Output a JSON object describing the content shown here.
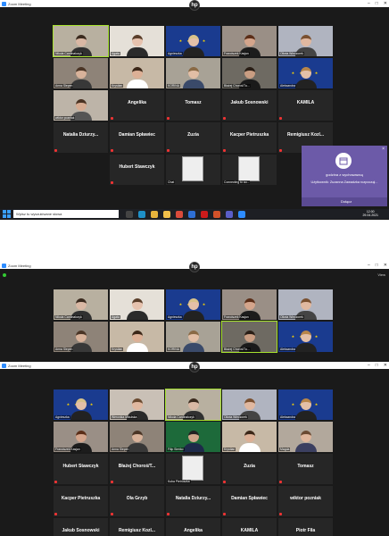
{
  "window": {
    "title": "Zoom Meeting",
    "logo_text": "hp",
    "controls": [
      "–",
      "□",
      "✕"
    ]
  },
  "screenshot1": {
    "rows": [
      [
        {
          "name": "Nikola Cardinalczyk",
          "style": "video",
          "skin": "#d9b8a4",
          "hair": "#3a2a1e",
          "shirt": "#303030",
          "bg": "#b8b0a0",
          "active": true
        },
        {
          "name": "Agata",
          "style": "video",
          "skin": "#e6c2ae",
          "hair": "#5a3e2a",
          "shirt": "#2b2b2b",
          "bg": "#e5e0d8"
        },
        {
          "name": "Agnieszka",
          "style": "flag",
          "skin": "#e3c0a8",
          "hair": "#d8c28a",
          "shirt": "#222"
        },
        {
          "name": "Franciszek Kasjan",
          "style": "video",
          "skin": "#d4a58c",
          "hair": "#5b2e18",
          "shirt": "#1c1c1c",
          "bg": "#9a8f86"
        },
        {
          "name": "Oliwia Wieczorek",
          "style": "video",
          "skin": "#e0b8a0",
          "hair": "#7a5030",
          "shirt": "#444",
          "bg": "#b0b4c0"
        }
      ],
      [
        {
          "name": "Anna Slepen",
          "style": "video",
          "skin": "#d8b29a",
          "hair": "#4b3526",
          "shirt": "#383838",
          "bg": "#8e8378"
        },
        {
          "name": "Krystian",
          "style": "video",
          "skin": "#dcb096",
          "hair": "#3c2718",
          "shirt": "#ffffff",
          "bg": "#c7b9a6"
        },
        {
          "name": "KORINA",
          "style": "video",
          "skin": "#e2bea5",
          "hair": "#8a6a45",
          "shirt": "#3a4a6a",
          "bg": "#a8a296"
        },
        {
          "name": "Błażej Choroś/Tu...",
          "style": "video",
          "skin": "#c99d82",
          "hair": "#2a1e16",
          "shirt": "#1a1a1a",
          "bg": "#6e6a62"
        },
        {
          "name": "Aleksandra",
          "style": "flag",
          "skin": "#e3c0a8",
          "hair": "#b8864a",
          "shirt": "#222"
        }
      ],
      [
        {
          "name": "wiktor pozniak",
          "style": "video",
          "skin": "#d7ac92",
          "hair": "#4a3222",
          "shirt": "#555",
          "bg": "#bdb4a8"
        },
        {
          "name": "Angelika",
          "style": "text"
        },
        {
          "name": "Tomasz",
          "style": "text"
        },
        {
          "name": "Jakub Sosnowski",
          "style": "text"
        },
        {
          "name": "KAMILA",
          "style": "text"
        }
      ],
      [
        {
          "name": "Natalia Dziurzy...",
          "style": "text"
        },
        {
          "name": "Damian Spławiec",
          "style": "text"
        },
        {
          "name": "Zuzia",
          "style": "text"
        },
        {
          "name": "Kacper Pietruszka",
          "style": "text"
        },
        {
          "name": "Remigiusz Kozl...",
          "style": "text"
        }
      ],
      [
        {
          "name": "",
          "style": "empty"
        },
        {
          "name": "Hubert Stawczyk",
          "style": "text"
        },
        {
          "name": "Chat",
          "style": "anime"
        },
        {
          "name": "Connecting to au...",
          "style": "anime"
        },
        {
          "name": "",
          "style": "empty"
        }
      ]
    ],
    "taskbar": {
      "search_placeholder": "Wpisz tu wyszukiwane słowa",
      "time": "12:00",
      "date": "29.04.2021"
    },
    "notification": {
      "title": "godzina z wychowawcą",
      "message": "Użytkownik: Zuzanna Zawadzka rozpoczął...",
      "join_label": "Dołącz"
    }
  },
  "screenshot2": {
    "views_label": "View",
    "rows": [
      [
        {
          "name": "Nikola Cardinalczyk",
          "style": "video",
          "skin": "#d9b8a4",
          "hair": "#3a2a1e",
          "shirt": "#303030",
          "bg": "#b8b0a0"
        },
        {
          "name": "Agata",
          "style": "video",
          "skin": "#e6c2ae",
          "hair": "#5a3e2a",
          "shirt": "#2b2b2b",
          "bg": "#e5e0d8"
        },
        {
          "name": "Agnieszka",
          "style": "flag",
          "skin": "#e3c0a8",
          "hair": "#d8c28a",
          "shirt": "#222"
        },
        {
          "name": "Franciszek Kasjan",
          "style": "video",
          "skin": "#d4a58c",
          "hair": "#5b2e18",
          "shirt": "#1c1c1c",
          "bg": "#9a8f86"
        },
        {
          "name": "Oliwia Wieczorek",
          "style": "video",
          "skin": "#e0b8a0",
          "hair": "#7a5030",
          "shirt": "#444",
          "bg": "#b0b4c0"
        }
      ],
      [
        {
          "name": "Anna Slepen",
          "style": "video",
          "skin": "#d8b29a",
          "hair": "#4b3526",
          "shirt": "#383838",
          "bg": "#8e8378"
        },
        {
          "name": "Krystian",
          "style": "video",
          "skin": "#dcb096",
          "hair": "#3c2718",
          "shirt": "#ffffff",
          "bg": "#c7b9a6"
        },
        {
          "name": "KORINA",
          "style": "video",
          "skin": "#e2bea5",
          "hair": "#8a6a45",
          "shirt": "#3a4a6a",
          "bg": "#a8a296"
        },
        {
          "name": "Błażej Choroś/Tu...",
          "style": "video",
          "skin": "#c99d82",
          "hair": "#2a1e16",
          "shirt": "#1a1a1a",
          "bg": "#6e6a62",
          "active": true
        },
        {
          "name": "Aleksandra",
          "style": "flag",
          "skin": "#e3c0a8",
          "hair": "#b8864a",
          "shirt": "#222"
        }
      ]
    ]
  },
  "screenshot3": {
    "rows": [
      [
        {
          "name": "Agnieszka",
          "style": "flag",
          "skin": "#e3c0a8",
          "hair": "#d8c28a",
          "shirt": "#222"
        },
        {
          "name": "Weronika Mikulska",
          "style": "video",
          "skin": "#e0b8a0",
          "hair": "#6a4a30",
          "shirt": "#2a2a2a",
          "bg": "#c9c0b6"
        },
        {
          "name": "Nikola Cardinalczyk",
          "style": "video",
          "skin": "#d9b8a4",
          "hair": "#3a2a1e",
          "shirt": "#303030",
          "bg": "#b8b0a0",
          "active": true
        },
        {
          "name": "Oliwia Wieczorek",
          "style": "video",
          "skin": "#e0b8a0",
          "hair": "#7a5030",
          "shirt": "#444",
          "bg": "#b0b4c0"
        },
        {
          "name": "Aleksandra",
          "style": "flag",
          "skin": "#e3c0a8",
          "hair": "#b8864a",
          "shirt": "#222"
        }
      ],
      [
        {
          "name": "Franciszek Kasjan",
          "style": "video",
          "skin": "#d4a58c",
          "hair": "#5b2e18",
          "shirt": "#1c1c1c",
          "bg": "#9a8f86"
        },
        {
          "name": "Anna Slepen",
          "style": "video",
          "skin": "#d8b29a",
          "hair": "#4b3526",
          "shirt": "#383838",
          "bg": "#8e8378"
        },
        {
          "name": "Filip Sieńko",
          "style": "video",
          "skin": "#cfa58a",
          "hair": "#222",
          "shirt": "#1e2a4a",
          "bg": "#1d6a3a"
        },
        {
          "name": "Krystian",
          "style": "video",
          "skin": "#dcb096",
          "hair": "#3c2718",
          "shirt": "#ffffff",
          "bg": "#c7b9a6"
        },
        {
          "name": "Magda",
          "style": "video",
          "skin": "#dfb69c",
          "hair": "#6b4a32",
          "shirt": "#3b3f60",
          "bg": "#b2a89c"
        }
      ],
      [
        {
          "name": "Hubert Stawczyk",
          "style": "text"
        },
        {
          "name": "Błażej Choroś/T...",
          "style": "text"
        },
        {
          "name": "Kuba Pietruszka",
          "style": "anime"
        },
        {
          "name": "Zuzia",
          "style": "text"
        },
        {
          "name": "Tomasz",
          "style": "text"
        }
      ],
      [
        {
          "name": "Kacper Pietruszka",
          "style": "text"
        },
        {
          "name": "Ola Grzyb",
          "style": "text"
        },
        {
          "name": "Natalia Dziurzy...",
          "style": "text"
        },
        {
          "name": "Damian Spławiec",
          "style": "text"
        },
        {
          "name": "wiktor pozniak",
          "style": "text"
        }
      ],
      [
        {
          "name": "Jakub Sosnowski",
          "style": "text"
        },
        {
          "name": "Remigiusz Kozl...",
          "style": "text"
        },
        {
          "name": "Angelika",
          "style": "text"
        },
        {
          "name": "KAMILA",
          "style": "text"
        },
        {
          "name": "Piotr Fila",
          "style": "text"
        }
      ]
    ]
  }
}
